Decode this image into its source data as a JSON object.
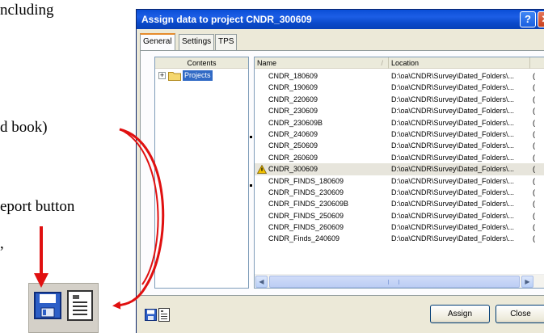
{
  "document": {
    "lines": [
      "ncluding",
      "d book)",
      "eport button",
      ","
    ]
  },
  "dialog": {
    "title": "Assign data to project CNDR_300609",
    "help_glyph": "?",
    "close_glyph": "✕",
    "tabs": [
      {
        "label": "General",
        "active": true
      },
      {
        "label": "Settings",
        "active": false
      },
      {
        "label": "TPS",
        "active": false
      }
    ],
    "tree": {
      "header": "Contents",
      "expander": "+",
      "items": [
        {
          "label": "Projects",
          "icon": "folder-icon",
          "selected": true
        }
      ]
    },
    "list": {
      "columns": [
        "Name",
        "Location",
        ""
      ],
      "sort_glyph": "/",
      "rows": [
        {
          "name": "CNDR_180609",
          "location": "D:\\oa\\CNDR\\Survey\\Dated_Folders\\...",
          "extra": "(",
          "icon": ""
        },
        {
          "name": "CNDR_190609",
          "location": "D:\\oa\\CNDR\\Survey\\Dated_Folders\\...",
          "extra": "(",
          "icon": ""
        },
        {
          "name": "CNDR_220609",
          "location": "D:\\oa\\CNDR\\Survey\\Dated_Folders\\...",
          "extra": "(",
          "icon": ""
        },
        {
          "name": "CNDR_230609",
          "location": "D:\\oa\\CNDR\\Survey\\Dated_Folders\\...",
          "extra": "(",
          "icon": ""
        },
        {
          "name": "CNDR_230609B",
          "location": "D:\\oa\\CNDR\\Survey\\Dated_Folders\\...",
          "extra": "(",
          "icon": ""
        },
        {
          "name": "CNDR_240609",
          "location": "D:\\oa\\CNDR\\Survey\\Dated_Folders\\...",
          "extra": "(",
          "icon": ""
        },
        {
          "name": "CNDR_250609",
          "location": "D:\\oa\\CNDR\\Survey\\Dated_Folders\\...",
          "extra": "(",
          "icon": ""
        },
        {
          "name": "CNDR_260609",
          "location": "D:\\oa\\CNDR\\Survey\\Dated_Folders\\...",
          "extra": "(",
          "icon": ""
        },
        {
          "name": "CNDR_300609",
          "location": "D:\\oa\\CNDR\\Survey\\Dated_Folders\\...",
          "extra": "(",
          "icon": "warning-icon",
          "selected": true
        },
        {
          "name": "CNDR_FINDS_180609",
          "location": "D:\\oa\\CNDR\\Survey\\Dated_Folders\\...",
          "extra": "(",
          "icon": ""
        },
        {
          "name": "CNDR_FINDS_230609",
          "location": "D:\\oa\\CNDR\\Survey\\Dated_Folders\\...",
          "extra": "(",
          "icon": ""
        },
        {
          "name": "CNDR_FINDS_230609B",
          "location": "D:\\oa\\CNDR\\Survey\\Dated_Folders\\...",
          "extra": "(",
          "icon": ""
        },
        {
          "name": "CNDR_FINDS_250609",
          "location": "D:\\oa\\CNDR\\Survey\\Dated_Folders\\...",
          "extra": "(",
          "icon": ""
        },
        {
          "name": "CNDR_FINDS_260609",
          "location": "D:\\oa\\CNDR\\Survey\\Dated_Folders\\...",
          "extra": "(",
          "icon": ""
        },
        {
          "name": "CNDR_Finds_240609",
          "location": "D:\\oa\\CNDR\\Survey\\Dated_Folders\\...",
          "extra": "(",
          "icon": ""
        }
      ]
    },
    "scrollbar": {
      "left_glyph": "◀",
      "right_glyph": "▶"
    },
    "footer": {
      "icons": [
        "save-icon",
        "report-icon"
      ],
      "assign_label": "Assign",
      "close_label": "Close"
    }
  },
  "colors": {
    "title_bar": "#0a4ed6",
    "annotation": "#e01010",
    "selection": "#316ac5",
    "warning": "#f2c200"
  }
}
